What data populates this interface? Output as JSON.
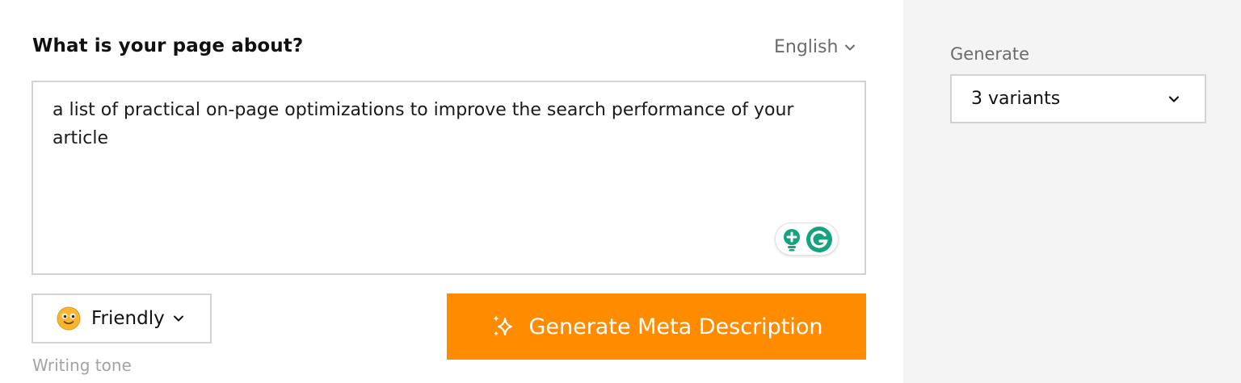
{
  "form": {
    "question": "What is your page about?",
    "language": "English",
    "description_value": "a list of practical on-page optimizations to improve the search performance of your article",
    "tone": {
      "selected": "Friendly",
      "caption": "Writing tone"
    },
    "generate_button_label": "Generate Meta Description"
  },
  "options": {
    "generate_label": "Generate",
    "variants_selected": "3 variants"
  },
  "colors": {
    "accent": "#ff8c00",
    "grammarly_green": "#15a37f",
    "panel_bg": "#f4f4f4"
  },
  "icons": {
    "language": "chevron-down-icon",
    "grammarly": "grammarly-icon",
    "tone": "smiley-emoji-icon",
    "generate": "sparkles-icon",
    "variants": "chevron-down-icon"
  }
}
